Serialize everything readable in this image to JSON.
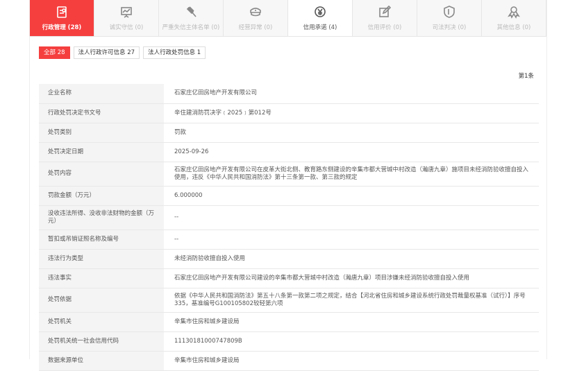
{
  "tabs": [
    {
      "label": "行政管理 (28)",
      "icon": "form-icon",
      "state": "active"
    },
    {
      "label": "诚实守信 (0)",
      "icon": "presentation-icon",
      "state": "disabled"
    },
    {
      "label": "严重失信主体名单 (0)",
      "icon": "gavel-icon",
      "state": "disabled"
    },
    {
      "label": "经营异常 (0)",
      "icon": "police-cap-icon",
      "state": "disabled"
    },
    {
      "label": "信用承诺 (4)",
      "icon": "yen-icon",
      "state": "enabled"
    },
    {
      "label": "信用评价 (0)",
      "icon": "edit-icon",
      "state": "disabled"
    },
    {
      "label": "司法判决 (0)",
      "icon": "shield-icon",
      "state": "disabled"
    },
    {
      "label": "其他信息 (0)",
      "icon": "award-icon",
      "state": "disabled"
    }
  ],
  "filters": [
    "全部 28",
    "法人行政许可信息 27",
    "法人行政处罚信息 1"
  ],
  "record_index": "第1条",
  "rows": [
    {
      "k": "企业名称",
      "v": "石家庄亿田房地产开发有限公司"
    },
    {
      "k": "行政处罚决定书文号",
      "v": "辛住建消防罚决字﹝2025﹞第012号"
    },
    {
      "k": "处罚类别",
      "v": "罚款"
    },
    {
      "k": "处罚决定日期",
      "v": "2025-09-26"
    },
    {
      "k": "处罚内容",
      "v": "石家庄亿田房地产开发有限公司在皮革大街北侧、教育路东侧建设的辛集市都大营城中村改造（瀚唐九章）施项目未经消防验收擅自投入使用，违反《中华人民共和国消防法》第十三条第一款、第三款的规定"
    },
    {
      "k": "罚款金额（万元）",
      "v": "6.000000"
    },
    {
      "k": "没收违法所得、没收非法财物的金额（万元）",
      "v": "--"
    },
    {
      "k": "暂扣或吊销证照名称及编号",
      "v": "--"
    },
    {
      "k": "违法行为类型",
      "v": "未经消防验收擅自投入使用"
    },
    {
      "k": "违法事实",
      "v": "石家庄亿田房地产开发有限公司建设的辛集市都大营城中村改造（瀚唐九章）项目涉嫌未经消防验收擅自投入使用"
    },
    {
      "k": "处罚依据",
      "v": "依据《中华人民共和国消防法》第五十八条第一款第二项之规定，结合【河北省住房和城乡建设系统行政处罚裁量权基准（试行）】序号335，基准编号G100105802较轻第六项"
    },
    {
      "k": "处罚机关",
      "v": "辛集市住房和城乡建设局"
    },
    {
      "k": "处罚机关统一社会信用代码",
      "v": "11130181000747809B"
    },
    {
      "k": "数据来源单位",
      "v": "辛集市住房和城乡建设局"
    }
  ]
}
